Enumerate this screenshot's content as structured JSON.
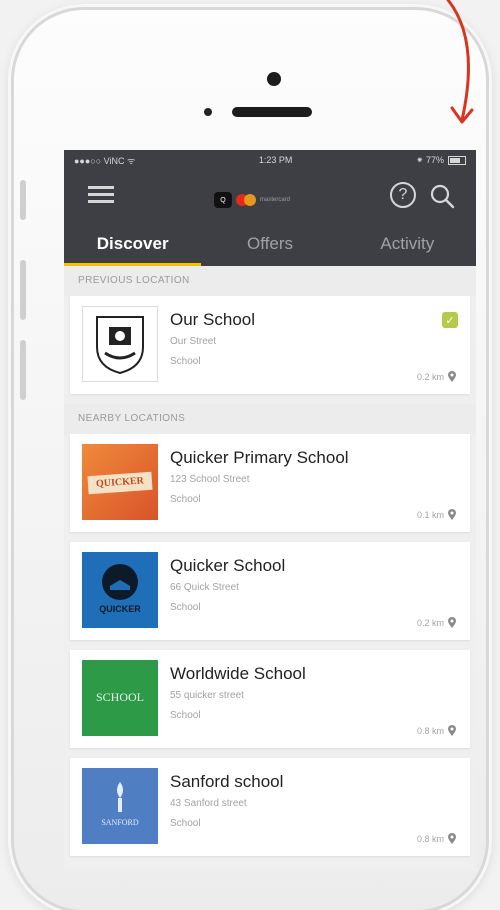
{
  "statusbar": {
    "carrier": "●●●○○ ViNC ᯤ",
    "time": "1:23 PM",
    "battery": "⁕ 77%"
  },
  "tabs": [
    {
      "label": "Discover"
    },
    {
      "label": "Offers"
    },
    {
      "label": "Activity"
    }
  ],
  "previous_header": "PREVIOUS LOCATION",
  "nearby_header": "NEARBY LOCATIONS",
  "previous": {
    "name": "Our School",
    "street": "Our Street",
    "category": "School",
    "distance": "0.2 km",
    "badge": "✓"
  },
  "nearby": [
    {
      "name": "Quicker Primary School",
      "street": "123 School Street",
      "category": "School",
      "distance": "0.1 km",
      "thumb_text": "QUICKER"
    },
    {
      "name": "Quicker School",
      "street": "66 Quick Street",
      "category": "School",
      "distance": "0.2 km",
      "thumb_text": "QUICKER"
    },
    {
      "name": "Worldwide School",
      "street": "55 quicker street",
      "category": "School",
      "distance": "0.8 km",
      "thumb_text": "SCHOOL"
    },
    {
      "name": "Sanford school",
      "street": "43 Sanford street",
      "category": "School",
      "distance": "0.8 km",
      "thumb_text": "SANFORD"
    }
  ],
  "logo": {
    "q_text": "Q",
    "mc_text": "mastercard"
  },
  "colors": {
    "navbar": "#3d3f45",
    "tab_accent": "#f5c400",
    "arrow": "#d9341f",
    "badge": "#b5c94a"
  }
}
